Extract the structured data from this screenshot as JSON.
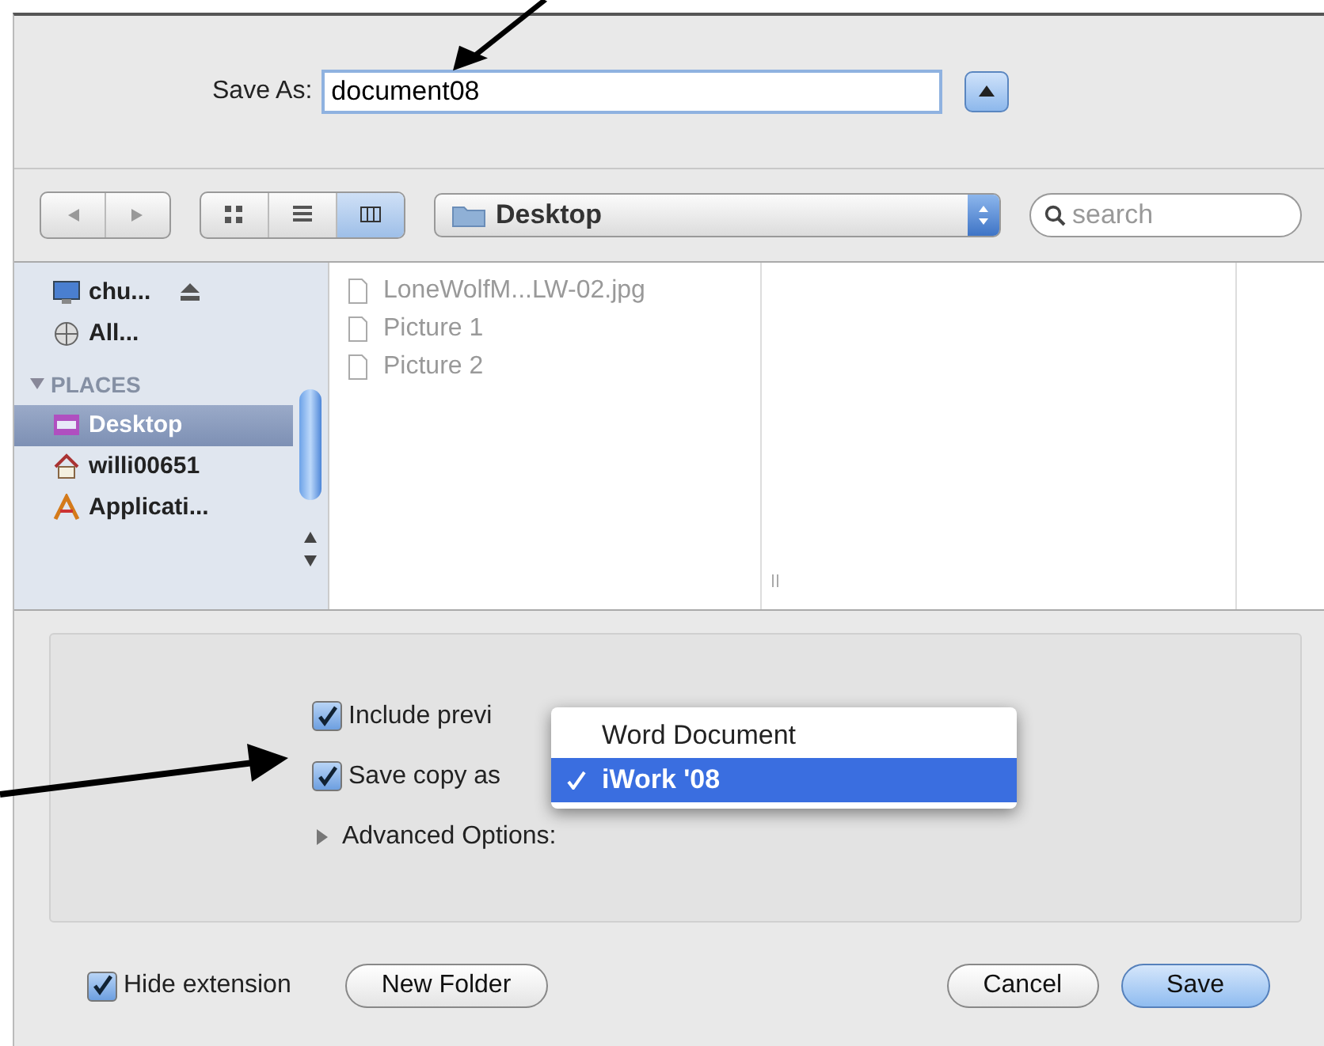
{
  "save_as": {
    "label": "Save As:",
    "value": "document08"
  },
  "toolbar": {
    "view_modes": [
      {
        "kind": "icons",
        "selected": false
      },
      {
        "kind": "list",
        "selected": false
      },
      {
        "kind": "columns",
        "selected": true
      }
    ],
    "location": "Desktop",
    "search": {
      "placeholder": "search"
    }
  },
  "sidebar": {
    "devices": [
      {
        "kind": "computer",
        "label": "chu...",
        "selected": false,
        "ejectable": true
      },
      {
        "kind": "network",
        "label": "All...",
        "selected": false,
        "ejectable": false
      }
    ],
    "places": {
      "label": "PLACES",
      "expanded": true,
      "items": [
        {
          "kind": "desktop",
          "label": "Desktop",
          "selected": true
        },
        {
          "kind": "home",
          "label": "willi00651",
          "selected": false
        },
        {
          "kind": "applications",
          "label": "Applicati...",
          "selected": false
        }
      ]
    }
  },
  "files": [
    "LoneWolfM...LW-02.jpg",
    "Picture 1",
    "Picture 2"
  ],
  "options": {
    "checkboxes": [
      {
        "label": "Include previ",
        "checked": true
      },
      {
        "label": "Save copy as",
        "checked": true
      }
    ],
    "advanced": {
      "label": "Advanced Options:",
      "expanded": false
    },
    "format_menu": [
      {
        "label": "Word Document",
        "selected": false
      },
      {
        "label": "iWork '08",
        "selected": true
      }
    ]
  },
  "footer": {
    "hide_extension": {
      "label": "Hide extension",
      "checked": true
    },
    "buttons": [
      {
        "label": "New Folder",
        "kind": "normal"
      },
      {
        "label": "Cancel",
        "kind": "normal"
      },
      {
        "label": "Save",
        "kind": "default"
      }
    ]
  }
}
